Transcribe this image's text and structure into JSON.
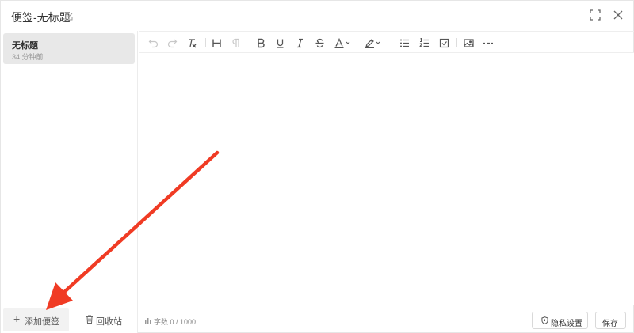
{
  "window": {
    "title": "便签-无标题"
  },
  "sidebar": {
    "notes": [
      {
        "title": "无标题",
        "time": "34 分钟前"
      }
    ],
    "add_button_label": "添加便签",
    "trash_button_label": "回收站"
  },
  "toolbar": {
    "items": [
      "undo-icon",
      "redo-icon",
      "clear-format-icon",
      "heading-icon",
      "paragraph-icon",
      "bold-icon",
      "underline-icon",
      "italic-icon",
      "strikethrough-icon",
      "font-color-icon",
      "highlight-icon",
      "bullet-list-icon",
      "ordered-list-icon",
      "checklist-icon",
      "image-icon",
      "horizontal-rule-icon"
    ]
  },
  "editor": {
    "content": ""
  },
  "footer": {
    "word_count": "字数 0 / 1000",
    "privacy_button_label": "隐私设置",
    "save_button_label": "保存"
  },
  "colors": {
    "annotation_arrow": "#f03b24",
    "selected_note_bg": "#e8e8e8"
  }
}
